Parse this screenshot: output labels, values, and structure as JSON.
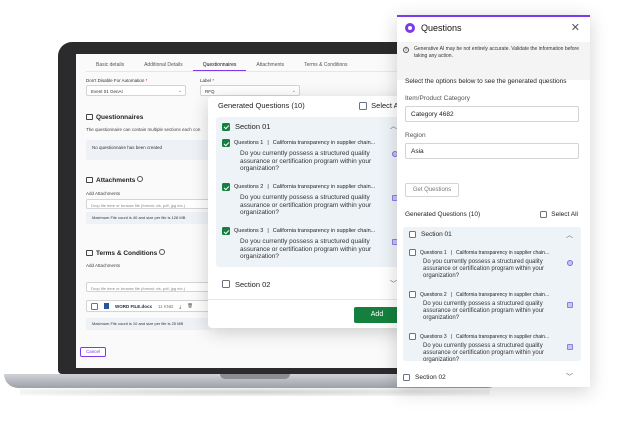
{
  "screen": {
    "tabs": [
      {
        "label": "Basic details"
      },
      {
        "label": "Additional Details"
      },
      {
        "label": "Questionnaires"
      },
      {
        "label": "Attachments"
      },
      {
        "label": "Terms & Conditions"
      }
    ],
    "fields": {
      "dont_disable_label": "Don't Disable For Automation",
      "dont_disable_value": "Event 01 GenAI",
      "label_label": "Label",
      "label_value": "RFQ"
    },
    "questionnaires": {
      "title": "Questionnaires",
      "desc": "The questionnaire can contain multiple sections each con",
      "empty": "No questionnaire has been created"
    },
    "attachments": {
      "title": "Attachments",
      "add_label": "Add Attachments",
      "drop_text": "Drop file here or browse file (format: xls, pdf, jpg etc.)",
      "max_text": "Maximum File count is 40 and size per file is 128 MB"
    },
    "terms": {
      "title": "Terms & Conditions",
      "add_label": "Add Attachments",
      "drop_text": "Drop file here or browse file (format: xls, pdf, jpg etc.)",
      "file_name": "WORD FILE.docx",
      "file_size": "11 KNB",
      "max_text": "Maximum File count is 10 and size per file is 25 MB"
    },
    "cancel_label": "Cancel"
  },
  "generated_card": {
    "title": "Generated Questions (10)",
    "select_all": "Select All",
    "section1": "Section 01",
    "section2": "Section 02",
    "questions": [
      {
        "num": "Questions 1",
        "tag": "California transparency in supplier chain...",
        "text": "Do you currently possess a structured quality assurance or certification program within your organization?"
      },
      {
        "num": "Questions 2",
        "tag": "California transparency in supplier chain...",
        "text": "Do you currently possess a structured quality assurance or certification program within your organization?"
      },
      {
        "num": "Questions 3",
        "tag": "California transparency in supplier chain...",
        "text": "Do you currently possess a structured quality assurance or certification program within your organization?"
      }
    ],
    "add_label": "Add"
  },
  "questions_panel": {
    "title": "Questions",
    "alert": "Generative AI may be not entirely accurate. Validate the information before taking any action.",
    "subtitle": "Select the options below to see the generated questions",
    "category_label": "Item/Product Category",
    "category_value": "Category 4682",
    "region_label": "Region",
    "region_value": "Asia",
    "get_label": "Get Questions",
    "gq_title": "Generated Questions (10)",
    "select_all": "Select All",
    "section1": "Section 01",
    "section2": "Section 02",
    "questions": [
      {
        "num": "Questions 1",
        "tag": "California transparency in supplier chain...",
        "text": "Do you currently possess a structured quality assurance or certification program within your organization?"
      },
      {
        "num": "Questions 2",
        "tag": "California transparency in supplier chain...",
        "text": "Do you currently possess a structured quality assurance or certification program within your organization?"
      },
      {
        "num": "Questions 3",
        "tag": "California transparency in supplier chain...",
        "text": "Do you currently possess a structured quality assurance or certification program within your organization?"
      }
    ]
  },
  "colors": {
    "accent": "#7c3aed",
    "success": "#15803d",
    "section_bg": "#eef3f8"
  }
}
